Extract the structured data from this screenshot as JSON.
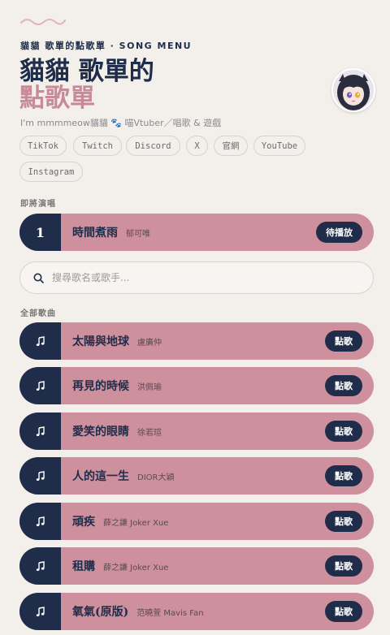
{
  "header": {
    "kicker": "貓貓 歌單的點歌單 · SONG MENU",
    "title_line1": "貓貓 歌單的",
    "title_line2": "點歌單",
    "bio": "I'm mmmmeow貓貓 🐾 喵Vtuber／唱歌 & 遊戲"
  },
  "avatar": {
    "icon": "avatar-anime-girl"
  },
  "social_links": [
    "TikTok",
    "Twitch",
    "Discord",
    "X",
    "官網",
    "YouTube",
    "Instagram"
  ],
  "upcoming": {
    "label": "即將演唱",
    "number": "1",
    "song": "時間煮雨",
    "artist": "郁可唯",
    "button": "待播放"
  },
  "search": {
    "placeholder": "搜尋歌名或歌手..."
  },
  "all_songs": {
    "label": "全部歌曲",
    "button_label": "點歌",
    "items": [
      {
        "song": "太陽與地球",
        "artist": "盧廣仲"
      },
      {
        "song": "再見的時候",
        "artist": "洪佩瑜"
      },
      {
        "song": "愛笑的眼睛",
        "artist": "徐若瑄"
      },
      {
        "song": "人的這一生",
        "artist": "DIOR大穎"
      },
      {
        "song": "頑疾",
        "artist": "薛之謙 Joker Xue"
      },
      {
        "song": "租購",
        "artist": "薛之謙 Joker Xue"
      },
      {
        "song": "氧氣(原版)",
        "artist": "范曉萱 Mavis Fan"
      }
    ]
  },
  "colors": {
    "navy": "#1f2d4b",
    "rose": "#cd909c",
    "background": "#f3efeb"
  }
}
